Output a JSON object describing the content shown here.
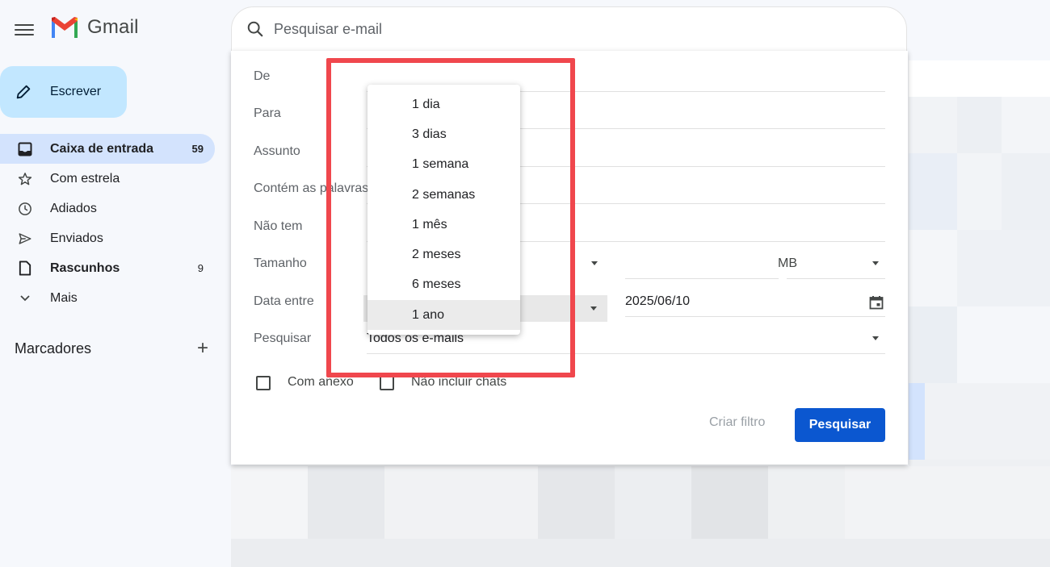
{
  "app": {
    "name": "Gmail"
  },
  "search": {
    "placeholder": "Pesquisar e-mail"
  },
  "sidebar": {
    "compose_label": "Escrever",
    "items": [
      {
        "label": "Caixa de entrada",
        "count": "59",
        "icon": "inbox-icon"
      },
      {
        "label": "Com estrela",
        "count": "",
        "icon": "star-icon"
      },
      {
        "label": "Adiados",
        "count": "",
        "icon": "clock-icon"
      },
      {
        "label": "Enviados",
        "count": "",
        "icon": "send-icon"
      },
      {
        "label": "Rascunhos",
        "count": "9",
        "icon": "draft-icon"
      },
      {
        "label": "Mais",
        "count": "",
        "icon": "chevron-down-icon"
      }
    ],
    "labels_title": "Marcadores",
    "labels_add": "+"
  },
  "panel": {
    "from_label": "De",
    "to_label": "Para",
    "subject_label": "Assunto",
    "has_words_label": "Contém as palavras",
    "doesnt_have_label": "Não tem",
    "size_label": "Tamanho",
    "size_unit": "MB",
    "date_within_label": "Data entre",
    "date_value": "2025/06/10",
    "search_in_label": "Pesquisar",
    "search_in_value": "Todos os e-mails",
    "has_attachment_label": "Com anexo",
    "exclude_chats_label": "Não incluir chats",
    "create_filter_label": "Criar filtro",
    "search_button_label": "Pesquisar"
  },
  "dropdown": {
    "options": [
      "1 dia",
      "3 dias",
      "1 semana",
      "2 semanas",
      "1 mês",
      "2 meses",
      "6 meses",
      "1 ano"
    ],
    "selected": "1 ano"
  },
  "colors": {
    "accent": "#0b57d0",
    "compose": "#c2e7ff",
    "active_nav": "#d3e3fd",
    "highlight": "#f0474d"
  }
}
